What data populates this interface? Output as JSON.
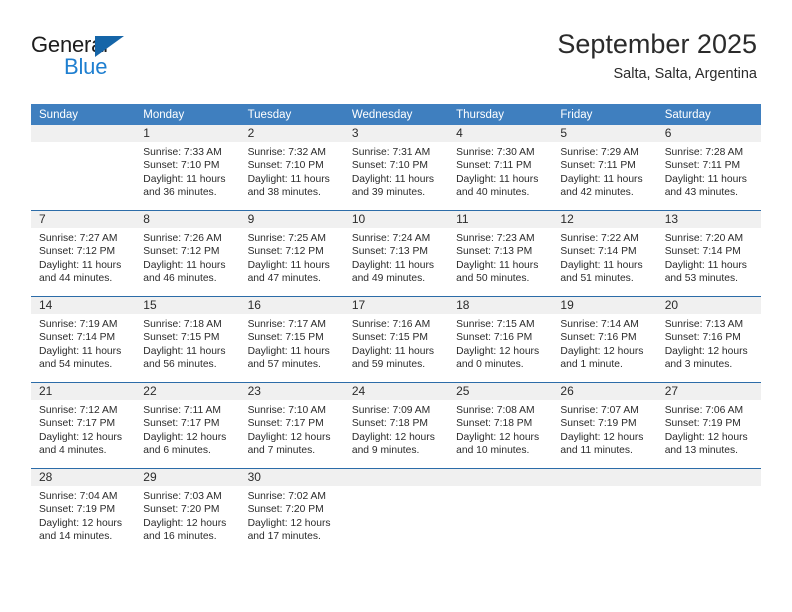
{
  "brand": {
    "name_top": "General",
    "name_bottom": "Blue",
    "accent_color": "#1f7fd0",
    "triangle_color": "#1565a8"
  },
  "header": {
    "title": "September 2025",
    "subtitle": "Salta, Salta, Argentina"
  },
  "theme": {
    "header_row_bg": "#3f7fbf",
    "header_row_text": "#ffffff",
    "daynum_bg": "#f0f0f0",
    "week_separator": "#2c6ca8",
    "body_text": "#2b2b2b"
  },
  "weekday_headers": [
    "Sunday",
    "Monday",
    "Tuesday",
    "Wednesday",
    "Thursday",
    "Friday",
    "Saturday"
  ],
  "labels": {
    "sunrise_prefix": "Sunrise:",
    "sunset_prefix": "Sunset:",
    "daylight_prefix": "Daylight:"
  },
  "weeks": [
    [
      {
        "day": "",
        "sunrise": "",
        "sunset": "",
        "daylight_line1": "",
        "daylight_line2": ""
      },
      {
        "day": "1",
        "sunrise": "Sunrise: 7:33 AM",
        "sunset": "Sunset: 7:10 PM",
        "daylight_line1": "Daylight: 11 hours",
        "daylight_line2": "and 36 minutes."
      },
      {
        "day": "2",
        "sunrise": "Sunrise: 7:32 AM",
        "sunset": "Sunset: 7:10 PM",
        "daylight_line1": "Daylight: 11 hours",
        "daylight_line2": "and 38 minutes."
      },
      {
        "day": "3",
        "sunrise": "Sunrise: 7:31 AM",
        "sunset": "Sunset: 7:10 PM",
        "daylight_line1": "Daylight: 11 hours",
        "daylight_line2": "and 39 minutes."
      },
      {
        "day": "4",
        "sunrise": "Sunrise: 7:30 AM",
        "sunset": "Sunset: 7:11 PM",
        "daylight_line1": "Daylight: 11 hours",
        "daylight_line2": "and 40 minutes."
      },
      {
        "day": "5",
        "sunrise": "Sunrise: 7:29 AM",
        "sunset": "Sunset: 7:11 PM",
        "daylight_line1": "Daylight: 11 hours",
        "daylight_line2": "and 42 minutes."
      },
      {
        "day": "6",
        "sunrise": "Sunrise: 7:28 AM",
        "sunset": "Sunset: 7:11 PM",
        "daylight_line1": "Daylight: 11 hours",
        "daylight_line2": "and 43 minutes."
      }
    ],
    [
      {
        "day": "7",
        "sunrise": "Sunrise: 7:27 AM",
        "sunset": "Sunset: 7:12 PM",
        "daylight_line1": "Daylight: 11 hours",
        "daylight_line2": "and 44 minutes."
      },
      {
        "day": "8",
        "sunrise": "Sunrise: 7:26 AM",
        "sunset": "Sunset: 7:12 PM",
        "daylight_line1": "Daylight: 11 hours",
        "daylight_line2": "and 46 minutes."
      },
      {
        "day": "9",
        "sunrise": "Sunrise: 7:25 AM",
        "sunset": "Sunset: 7:12 PM",
        "daylight_line1": "Daylight: 11 hours",
        "daylight_line2": "and 47 minutes."
      },
      {
        "day": "10",
        "sunrise": "Sunrise: 7:24 AM",
        "sunset": "Sunset: 7:13 PM",
        "daylight_line1": "Daylight: 11 hours",
        "daylight_line2": "and 49 minutes."
      },
      {
        "day": "11",
        "sunrise": "Sunrise: 7:23 AM",
        "sunset": "Sunset: 7:13 PM",
        "daylight_line1": "Daylight: 11 hours",
        "daylight_line2": "and 50 minutes."
      },
      {
        "day": "12",
        "sunrise": "Sunrise: 7:22 AM",
        "sunset": "Sunset: 7:14 PM",
        "daylight_line1": "Daylight: 11 hours",
        "daylight_line2": "and 51 minutes."
      },
      {
        "day": "13",
        "sunrise": "Sunrise: 7:20 AM",
        "sunset": "Sunset: 7:14 PM",
        "daylight_line1": "Daylight: 11 hours",
        "daylight_line2": "and 53 minutes."
      }
    ],
    [
      {
        "day": "14",
        "sunrise": "Sunrise: 7:19 AM",
        "sunset": "Sunset: 7:14 PM",
        "daylight_line1": "Daylight: 11 hours",
        "daylight_line2": "and 54 minutes."
      },
      {
        "day": "15",
        "sunrise": "Sunrise: 7:18 AM",
        "sunset": "Sunset: 7:15 PM",
        "daylight_line1": "Daylight: 11 hours",
        "daylight_line2": "and 56 minutes."
      },
      {
        "day": "16",
        "sunrise": "Sunrise: 7:17 AM",
        "sunset": "Sunset: 7:15 PM",
        "daylight_line1": "Daylight: 11 hours",
        "daylight_line2": "and 57 minutes."
      },
      {
        "day": "17",
        "sunrise": "Sunrise: 7:16 AM",
        "sunset": "Sunset: 7:15 PM",
        "daylight_line1": "Daylight: 11 hours",
        "daylight_line2": "and 59 minutes."
      },
      {
        "day": "18",
        "sunrise": "Sunrise: 7:15 AM",
        "sunset": "Sunset: 7:16 PM",
        "daylight_line1": "Daylight: 12 hours",
        "daylight_line2": "and 0 minutes."
      },
      {
        "day": "19",
        "sunrise": "Sunrise: 7:14 AM",
        "sunset": "Sunset: 7:16 PM",
        "daylight_line1": "Daylight: 12 hours",
        "daylight_line2": "and 1 minute."
      },
      {
        "day": "20",
        "sunrise": "Sunrise: 7:13 AM",
        "sunset": "Sunset: 7:16 PM",
        "daylight_line1": "Daylight: 12 hours",
        "daylight_line2": "and 3 minutes."
      }
    ],
    [
      {
        "day": "21",
        "sunrise": "Sunrise: 7:12 AM",
        "sunset": "Sunset: 7:17 PM",
        "daylight_line1": "Daylight: 12 hours",
        "daylight_line2": "and 4 minutes."
      },
      {
        "day": "22",
        "sunrise": "Sunrise: 7:11 AM",
        "sunset": "Sunset: 7:17 PM",
        "daylight_line1": "Daylight: 12 hours",
        "daylight_line2": "and 6 minutes."
      },
      {
        "day": "23",
        "sunrise": "Sunrise: 7:10 AM",
        "sunset": "Sunset: 7:17 PM",
        "daylight_line1": "Daylight: 12 hours",
        "daylight_line2": "and 7 minutes."
      },
      {
        "day": "24",
        "sunrise": "Sunrise: 7:09 AM",
        "sunset": "Sunset: 7:18 PM",
        "daylight_line1": "Daylight: 12 hours",
        "daylight_line2": "and 9 minutes."
      },
      {
        "day": "25",
        "sunrise": "Sunrise: 7:08 AM",
        "sunset": "Sunset: 7:18 PM",
        "daylight_line1": "Daylight: 12 hours",
        "daylight_line2": "and 10 minutes."
      },
      {
        "day": "26",
        "sunrise": "Sunrise: 7:07 AM",
        "sunset": "Sunset: 7:19 PM",
        "daylight_line1": "Daylight: 12 hours",
        "daylight_line2": "and 11 minutes."
      },
      {
        "day": "27",
        "sunrise": "Sunrise: 7:06 AM",
        "sunset": "Sunset: 7:19 PM",
        "daylight_line1": "Daylight: 12 hours",
        "daylight_line2": "and 13 minutes."
      }
    ],
    [
      {
        "day": "28",
        "sunrise": "Sunrise: 7:04 AM",
        "sunset": "Sunset: 7:19 PM",
        "daylight_line1": "Daylight: 12 hours",
        "daylight_line2": "and 14 minutes."
      },
      {
        "day": "29",
        "sunrise": "Sunrise: 7:03 AM",
        "sunset": "Sunset: 7:20 PM",
        "daylight_line1": "Daylight: 12 hours",
        "daylight_line2": "and 16 minutes."
      },
      {
        "day": "30",
        "sunrise": "Sunrise: 7:02 AM",
        "sunset": "Sunset: 7:20 PM",
        "daylight_line1": "Daylight: 12 hours",
        "daylight_line2": "and 17 minutes."
      },
      {
        "day": "",
        "sunrise": "",
        "sunset": "",
        "daylight_line1": "",
        "daylight_line2": ""
      },
      {
        "day": "",
        "sunrise": "",
        "sunset": "",
        "daylight_line1": "",
        "daylight_line2": ""
      },
      {
        "day": "",
        "sunrise": "",
        "sunset": "",
        "daylight_line1": "",
        "daylight_line2": ""
      },
      {
        "day": "",
        "sunrise": "",
        "sunset": "",
        "daylight_line1": "",
        "daylight_line2": ""
      }
    ]
  ]
}
